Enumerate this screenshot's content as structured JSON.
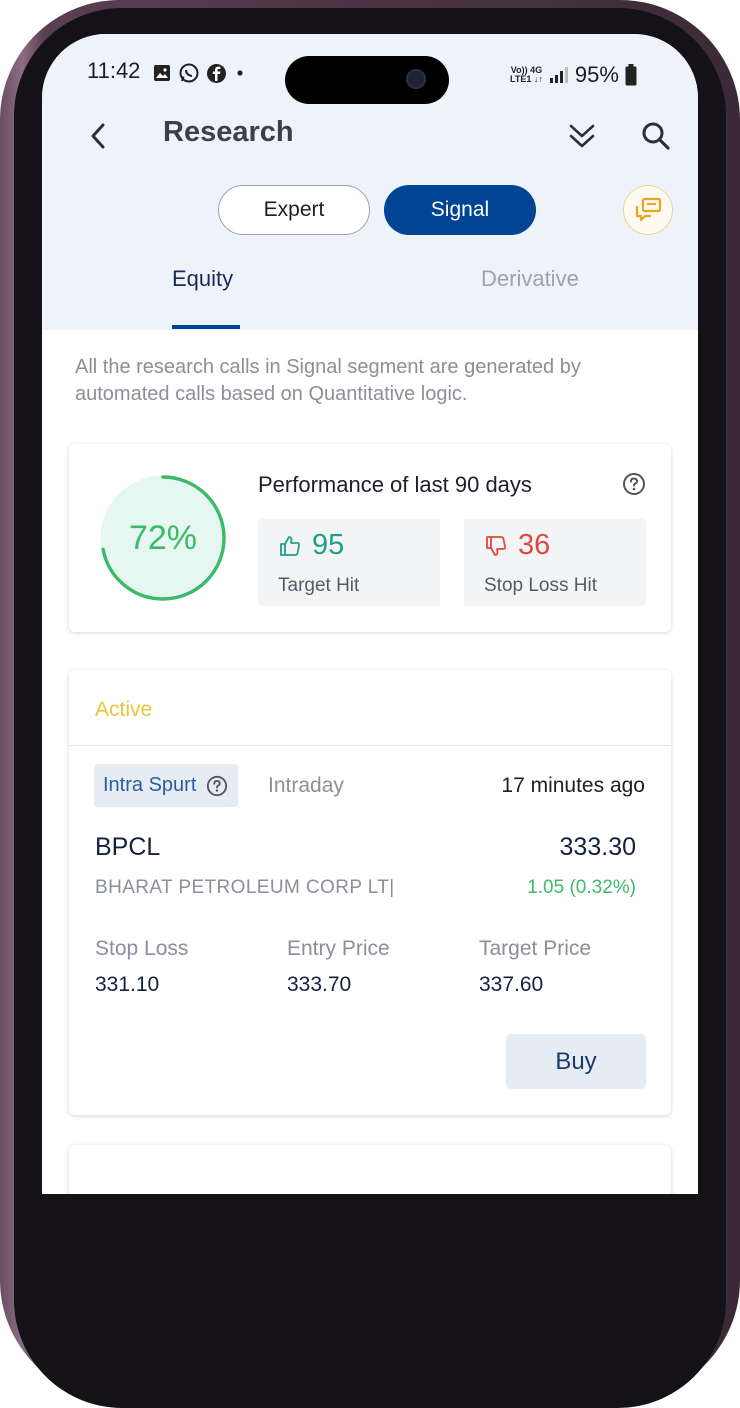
{
  "status_bar": {
    "time": "11:42",
    "lte_top": "Vo)) 4G",
    "lte_bottom": "LTE1 ↓↑",
    "battery": "95%"
  },
  "header": {
    "title": "Research",
    "icons": [
      "back-arrow-icon",
      "double-chevron-down-icon",
      "search-icon"
    ]
  },
  "segments": {
    "expert": "Expert",
    "signal": "Signal",
    "selected": "Signal"
  },
  "tabs": [
    {
      "label": "Equity",
      "active": true
    },
    {
      "label": "Derivative",
      "active": false
    }
  ],
  "disclaimer": "All the research calls in Signal segment are generated by automated calls based on Quantitative logic.",
  "performance": {
    "accuracy_label": "72%",
    "accuracy_fraction": 0.72,
    "title": "Performance of last 90 days",
    "target_hit": {
      "value": "95",
      "label": "Target Hit"
    },
    "stop_loss_hit": {
      "value": "36",
      "label": "Stop Loss Hit"
    }
  },
  "signal_card": {
    "status": "Active",
    "strategy": "Intra Spurt",
    "type": "Intraday",
    "time_ago": "17 minutes ago",
    "symbol": "BPCL",
    "price": "333.30",
    "company": "BHARAT PETROLEUM CORP  LT|",
    "change": "1.05 (0.32%)",
    "stop_loss": {
      "label": "Stop Loss",
      "value": "331.10"
    },
    "entry_price": {
      "label": "Entry Price",
      "value": "333.70"
    },
    "target_price": {
      "label": "Target Price",
      "value": "337.60"
    },
    "action": "Buy"
  },
  "colors": {
    "primary": "#004593",
    "gain": "#3cba6a",
    "loss": "#e0493e",
    "active": "#e8c63a"
  }
}
